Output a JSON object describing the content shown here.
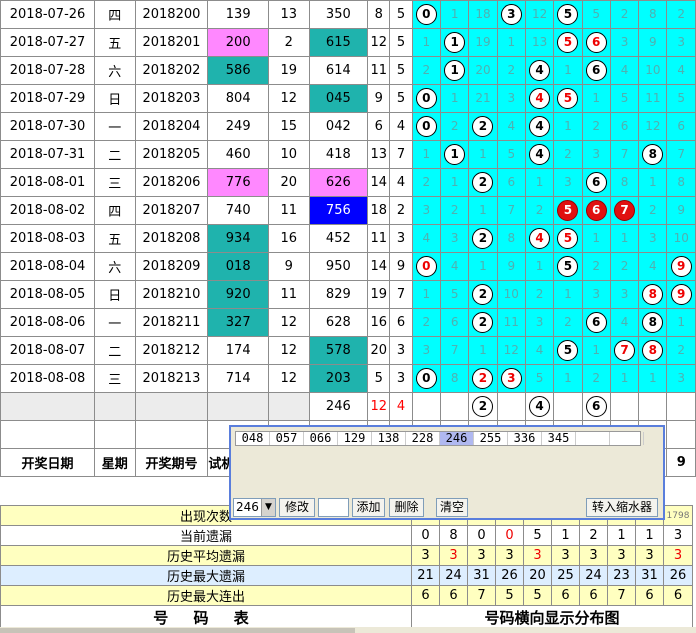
{
  "rows": [
    {
      "date": "2018-07-26",
      "wd": "四",
      "period": "2018200",
      "test": "139",
      "tc": "",
      "n": "13",
      "draw": "350",
      "dc": "",
      "s": "8",
      "sr": false,
      "k": "5",
      "dist": [
        [
          "0",
          "w"
        ],
        [
          "1",
          ""
        ],
        [
          "18",
          ""
        ],
        [
          "3",
          "w"
        ],
        [
          "12",
          ""
        ],
        [
          "5",
          "w"
        ],
        [
          "5",
          ""
        ],
        [
          "2",
          ""
        ],
        [
          "8",
          ""
        ],
        [
          "2",
          ""
        ]
      ]
    },
    {
      "date": "2018-07-27",
      "wd": "五",
      "period": "2018201",
      "test": "200",
      "tc": "pink",
      "n": "2",
      "draw": "615",
      "dc": "teal",
      "s": "12",
      "sr": false,
      "k": "5",
      "dist": [
        [
          "1",
          ""
        ],
        [
          "1",
          "w"
        ],
        [
          "19",
          ""
        ],
        [
          "1",
          ""
        ],
        [
          "13",
          ""
        ],
        [
          "5",
          "wr"
        ],
        [
          "6",
          "wr"
        ],
        [
          "3",
          ""
        ],
        [
          "9",
          ""
        ],
        [
          "3",
          ""
        ]
      ]
    },
    {
      "date": "2018-07-28",
      "wd": "六",
      "period": "2018202",
      "test": "586",
      "tc": "teal",
      "n": "19",
      "draw": "614",
      "dc": "",
      "s": "11",
      "sr": false,
      "k": "5",
      "dist": [
        [
          "2",
          ""
        ],
        [
          "1",
          "w"
        ],
        [
          "20",
          ""
        ],
        [
          "2",
          ""
        ],
        [
          "4",
          "w"
        ],
        [
          "1",
          ""
        ],
        [
          "6",
          "w"
        ],
        [
          "4",
          ""
        ],
        [
          "10",
          ""
        ],
        [
          "4",
          ""
        ]
      ]
    },
    {
      "date": "2018-07-29",
      "wd": "日",
      "period": "2018203",
      "test": "804",
      "tc": "",
      "n": "12",
      "draw": "045",
      "dc": "teal",
      "s": "9",
      "sr": false,
      "k": "5",
      "dist": [
        [
          "0",
          "w"
        ],
        [
          "1",
          ""
        ],
        [
          "21",
          ""
        ],
        [
          "3",
          ""
        ],
        [
          "4",
          "wr"
        ],
        [
          "5",
          "wr"
        ],
        [
          "1",
          ""
        ],
        [
          "5",
          ""
        ],
        [
          "11",
          ""
        ],
        [
          "5",
          ""
        ]
      ]
    },
    {
      "date": "2018-07-30",
      "wd": "一",
      "period": "2018204",
      "test": "249",
      "tc": "",
      "n": "15",
      "draw": "042",
      "dc": "",
      "s": "6",
      "sr": false,
      "k": "4",
      "dist": [
        [
          "0",
          "w"
        ],
        [
          "2",
          ""
        ],
        [
          "2",
          "w"
        ],
        [
          "4",
          ""
        ],
        [
          "4",
          "w"
        ],
        [
          "1",
          ""
        ],
        [
          "2",
          ""
        ],
        [
          "6",
          ""
        ],
        [
          "12",
          ""
        ],
        [
          "6",
          ""
        ]
      ]
    },
    {
      "date": "2018-07-31",
      "wd": "二",
      "period": "2018205",
      "test": "460",
      "tc": "",
      "n": "10",
      "draw": "418",
      "dc": "",
      "s": "13",
      "sr": false,
      "k": "7",
      "dist": [
        [
          "1",
          ""
        ],
        [
          "1",
          "w"
        ],
        [
          "1",
          ""
        ],
        [
          "5",
          ""
        ],
        [
          "4",
          "w"
        ],
        [
          "2",
          ""
        ],
        [
          "3",
          ""
        ],
        [
          "7",
          ""
        ],
        [
          "8",
          "w"
        ],
        [
          "7",
          ""
        ]
      ]
    },
    {
      "date": "2018-08-01",
      "wd": "三",
      "period": "2018206",
      "test": "776",
      "tc": "pink",
      "n": "20",
      "draw": "626",
      "dc": "pink",
      "s": "14",
      "sr": false,
      "k": "4",
      "dist": [
        [
          "2",
          ""
        ],
        [
          "1",
          ""
        ],
        [
          "2",
          "w"
        ],
        [
          "6",
          ""
        ],
        [
          "1",
          ""
        ],
        [
          "3",
          ""
        ],
        [
          "6",
          "w"
        ],
        [
          "8",
          ""
        ],
        [
          "1",
          ""
        ],
        [
          "8",
          ""
        ]
      ]
    },
    {
      "date": "2018-08-02",
      "wd": "四",
      "period": "2018207",
      "test": "740",
      "tc": "",
      "n": "11",
      "draw": "756",
      "dc": "blue",
      "s": "18",
      "sr": false,
      "k": "2",
      "dist": [
        [
          "3",
          ""
        ],
        [
          "2",
          ""
        ],
        [
          "1",
          ""
        ],
        [
          "7",
          ""
        ],
        [
          "2",
          ""
        ],
        [
          "5",
          "r"
        ],
        [
          "6",
          "r"
        ],
        [
          "7",
          "r"
        ],
        [
          "2",
          ""
        ],
        [
          "9",
          ""
        ]
      ]
    },
    {
      "date": "2018-08-03",
      "wd": "五",
      "period": "2018208",
      "test": "934",
      "tc": "teal",
      "n": "16",
      "draw": "452",
      "dc": "",
      "s": "11",
      "sr": false,
      "k": "3",
      "dist": [
        [
          "4",
          ""
        ],
        [
          "3",
          ""
        ],
        [
          "2",
          "w"
        ],
        [
          "8",
          ""
        ],
        [
          "4",
          "wr"
        ],
        [
          "5",
          "wr"
        ],
        [
          "1",
          ""
        ],
        [
          "1",
          ""
        ],
        [
          "3",
          ""
        ],
        [
          "10",
          ""
        ]
      ]
    },
    {
      "date": "2018-08-04",
      "wd": "六",
      "period": "2018209",
      "test": "018",
      "tc": "teal",
      "n": "9",
      "draw": "950",
      "dc": "",
      "s": "14",
      "sr": false,
      "k": "9",
      "dist": [
        [
          "0",
          "wr"
        ],
        [
          "4",
          ""
        ],
        [
          "1",
          ""
        ],
        [
          "9",
          ""
        ],
        [
          "1",
          ""
        ],
        [
          "5",
          "w"
        ],
        [
          "2",
          ""
        ],
        [
          "2",
          ""
        ],
        [
          "4",
          ""
        ],
        [
          "9",
          "wr"
        ]
      ]
    },
    {
      "date": "2018-08-05",
      "wd": "日",
      "period": "2018210",
      "test": "920",
      "tc": "teal",
      "n": "11",
      "draw": "829",
      "dc": "",
      "s": "19",
      "sr": false,
      "k": "7",
      "dist": [
        [
          "1",
          ""
        ],
        [
          "5",
          ""
        ],
        [
          "2",
          "w"
        ],
        [
          "10",
          ""
        ],
        [
          "2",
          ""
        ],
        [
          "1",
          ""
        ],
        [
          "3",
          ""
        ],
        [
          "3",
          ""
        ],
        [
          "8",
          "wr"
        ],
        [
          "9",
          "wr"
        ]
      ]
    },
    {
      "date": "2018-08-06",
      "wd": "一",
      "period": "2018211",
      "test": "327",
      "tc": "teal",
      "n": "12",
      "draw": "628",
      "dc": "",
      "s": "16",
      "sr": false,
      "k": "6",
      "dist": [
        [
          "2",
          ""
        ],
        [
          "6",
          ""
        ],
        [
          "2",
          "w"
        ],
        [
          "11",
          ""
        ],
        [
          "3",
          ""
        ],
        [
          "2",
          ""
        ],
        [
          "6",
          "w"
        ],
        [
          "4",
          ""
        ],
        [
          "8",
          "w"
        ],
        [
          "1",
          ""
        ]
      ]
    },
    {
      "date": "2018-08-07",
      "wd": "二",
      "period": "2018212",
      "test": "174",
      "tc": "",
      "n": "12",
      "draw": "578",
      "dc": "teal",
      "s": "20",
      "sr": false,
      "k": "3",
      "dist": [
        [
          "3",
          ""
        ],
        [
          "7",
          ""
        ],
        [
          "1",
          ""
        ],
        [
          "12",
          ""
        ],
        [
          "4",
          ""
        ],
        [
          "5",
          "w"
        ],
        [
          "1",
          ""
        ],
        [
          "7",
          "wr"
        ],
        [
          "8",
          "wr"
        ],
        [
          "2",
          ""
        ]
      ]
    },
    {
      "date": "2018-08-08",
      "wd": "三",
      "period": "2018213",
      "test": "714",
      "tc": "",
      "n": "12",
      "draw": "203",
      "dc": "teal",
      "s": "5",
      "sr": false,
      "k": "3",
      "dist": [
        [
          "0",
          "w"
        ],
        [
          "8",
          ""
        ],
        [
          "2",
          "wr"
        ],
        [
          "3",
          "wr"
        ],
        [
          "5",
          ""
        ],
        [
          "1",
          ""
        ],
        [
          "2",
          ""
        ],
        [
          "1",
          ""
        ],
        [
          "1",
          ""
        ],
        [
          "3",
          ""
        ]
      ]
    }
  ],
  "pending": {
    "draw": "246",
    "s": "12",
    "k": "4",
    "balls": [
      "2",
      "4",
      "6"
    ]
  },
  "popup": {
    "strip": [
      "048",
      "057",
      "066",
      "129",
      "138",
      "228",
      "246",
      "255",
      "336",
      "345",
      "",
      ""
    ],
    "selected": "246",
    "combo_value": "246",
    "btn_modify": "修改",
    "btn_add": "添加",
    "btn_delete": "删除",
    "btn_clear": "清空",
    "btn_convert": "转入缩水器"
  },
  "header": {
    "date": "开奖日期",
    "weekday": "星期",
    "period": "开奖期号",
    "test": "试机",
    "last_col": "9"
  },
  "stats": {
    "appear_label": "出现次数",
    "appear_value": "1798",
    "miss_label": "当前遗漏",
    "miss": [
      "0",
      "8",
      "0",
      "0",
      "5",
      "1",
      "2",
      "1",
      "1",
      "3"
    ],
    "avg_label": "历史平均遗漏",
    "avg": [
      "3",
      "3",
      "3",
      "3",
      "3",
      "3",
      "3",
      "3",
      "3",
      "3"
    ],
    "maxmiss_label": "历史最大遗漏",
    "maxmiss": [
      "21",
      "24",
      "31",
      "26",
      "20",
      "25",
      "24",
      "23",
      "31",
      "26"
    ],
    "maxrun_label": "历史最大连出",
    "maxrun": [
      "6",
      "6",
      "7",
      "5",
      "5",
      "6",
      "6",
      "7",
      "6",
      "6"
    ]
  },
  "titles": {
    "left": "号 码 表",
    "right": "号码横向显示分布图"
  }
}
